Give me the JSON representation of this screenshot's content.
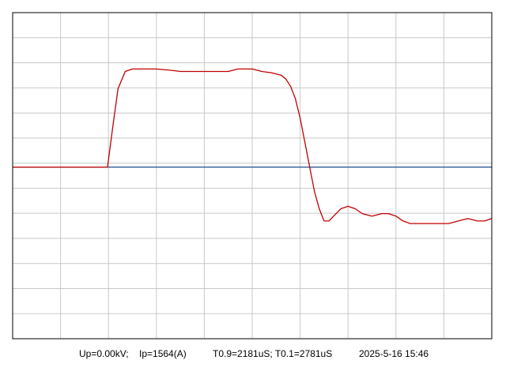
{
  "status": {
    "up": "Up=0.00kV;",
    "ip": "Ip=1564(A)",
    "times": "T0.9=2181uS; T0.1=2781uS",
    "datetime": "2025-5-16 15:46"
  },
  "colors": {
    "background": "#ffffff",
    "grid": "#c8c8c8",
    "frame": "#000000",
    "voltage_trace": "#1f4e8c",
    "current_trace": "#c00000"
  },
  "chart_data": {
    "type": "line",
    "grid": true,
    "xlim": [
      0,
      10
    ],
    "ylim": [
      -7,
      6.3
    ],
    "xgrid_divisions": 10,
    "ygrid_divisions": 13,
    "series": [
      {
        "color": "#1f4e8c",
        "x": [
          0,
          1,
          2,
          3,
          4,
          5,
          6,
          7,
          8,
          9,
          10
        ],
        "y": [
          0,
          0,
          0,
          0,
          0,
          0,
          0,
          0,
          0,
          0,
          0
        ]
      },
      {
        "color": "#c00000",
        "x": [
          0,
          1.0,
          1.98,
          2.02,
          2.1,
          2.2,
          2.35,
          2.5,
          2.65,
          2.8,
          3.0,
          3.3,
          3.5,
          3.8,
          4.0,
          4.3,
          4.5,
          4.7,
          4.85,
          5.0,
          5.2,
          5.4,
          5.6,
          5.7,
          5.8,
          5.9,
          6.0,
          6.1,
          6.2,
          6.3,
          6.4,
          6.5,
          6.6,
          6.7,
          6.85,
          7.0,
          7.15,
          7.3,
          7.5,
          7.7,
          7.85,
          8.0,
          8.15,
          8.3,
          8.5,
          8.7,
          8.9,
          9.1,
          9.3,
          9.5,
          9.7,
          9.85,
          10.0
        ],
        "y": [
          0,
          0,
          0,
          0.6,
          1.8,
          3.2,
          3.9,
          4.0,
          4.0,
          4.0,
          4.0,
          3.95,
          3.9,
          3.9,
          3.9,
          3.9,
          3.9,
          4.0,
          4.0,
          4.0,
          3.9,
          3.85,
          3.75,
          3.6,
          3.3,
          2.8,
          2.0,
          1.0,
          0.0,
          -1.0,
          -1.7,
          -2.2,
          -2.2,
          -2.0,
          -1.7,
          -1.6,
          -1.7,
          -1.9,
          -2.0,
          -1.9,
          -1.9,
          -2.0,
          -2.2,
          -2.3,
          -2.3,
          -2.3,
          -2.3,
          -2.3,
          -2.2,
          -2.1,
          -2.2,
          -2.2,
          -2.1
        ]
      }
    ]
  }
}
